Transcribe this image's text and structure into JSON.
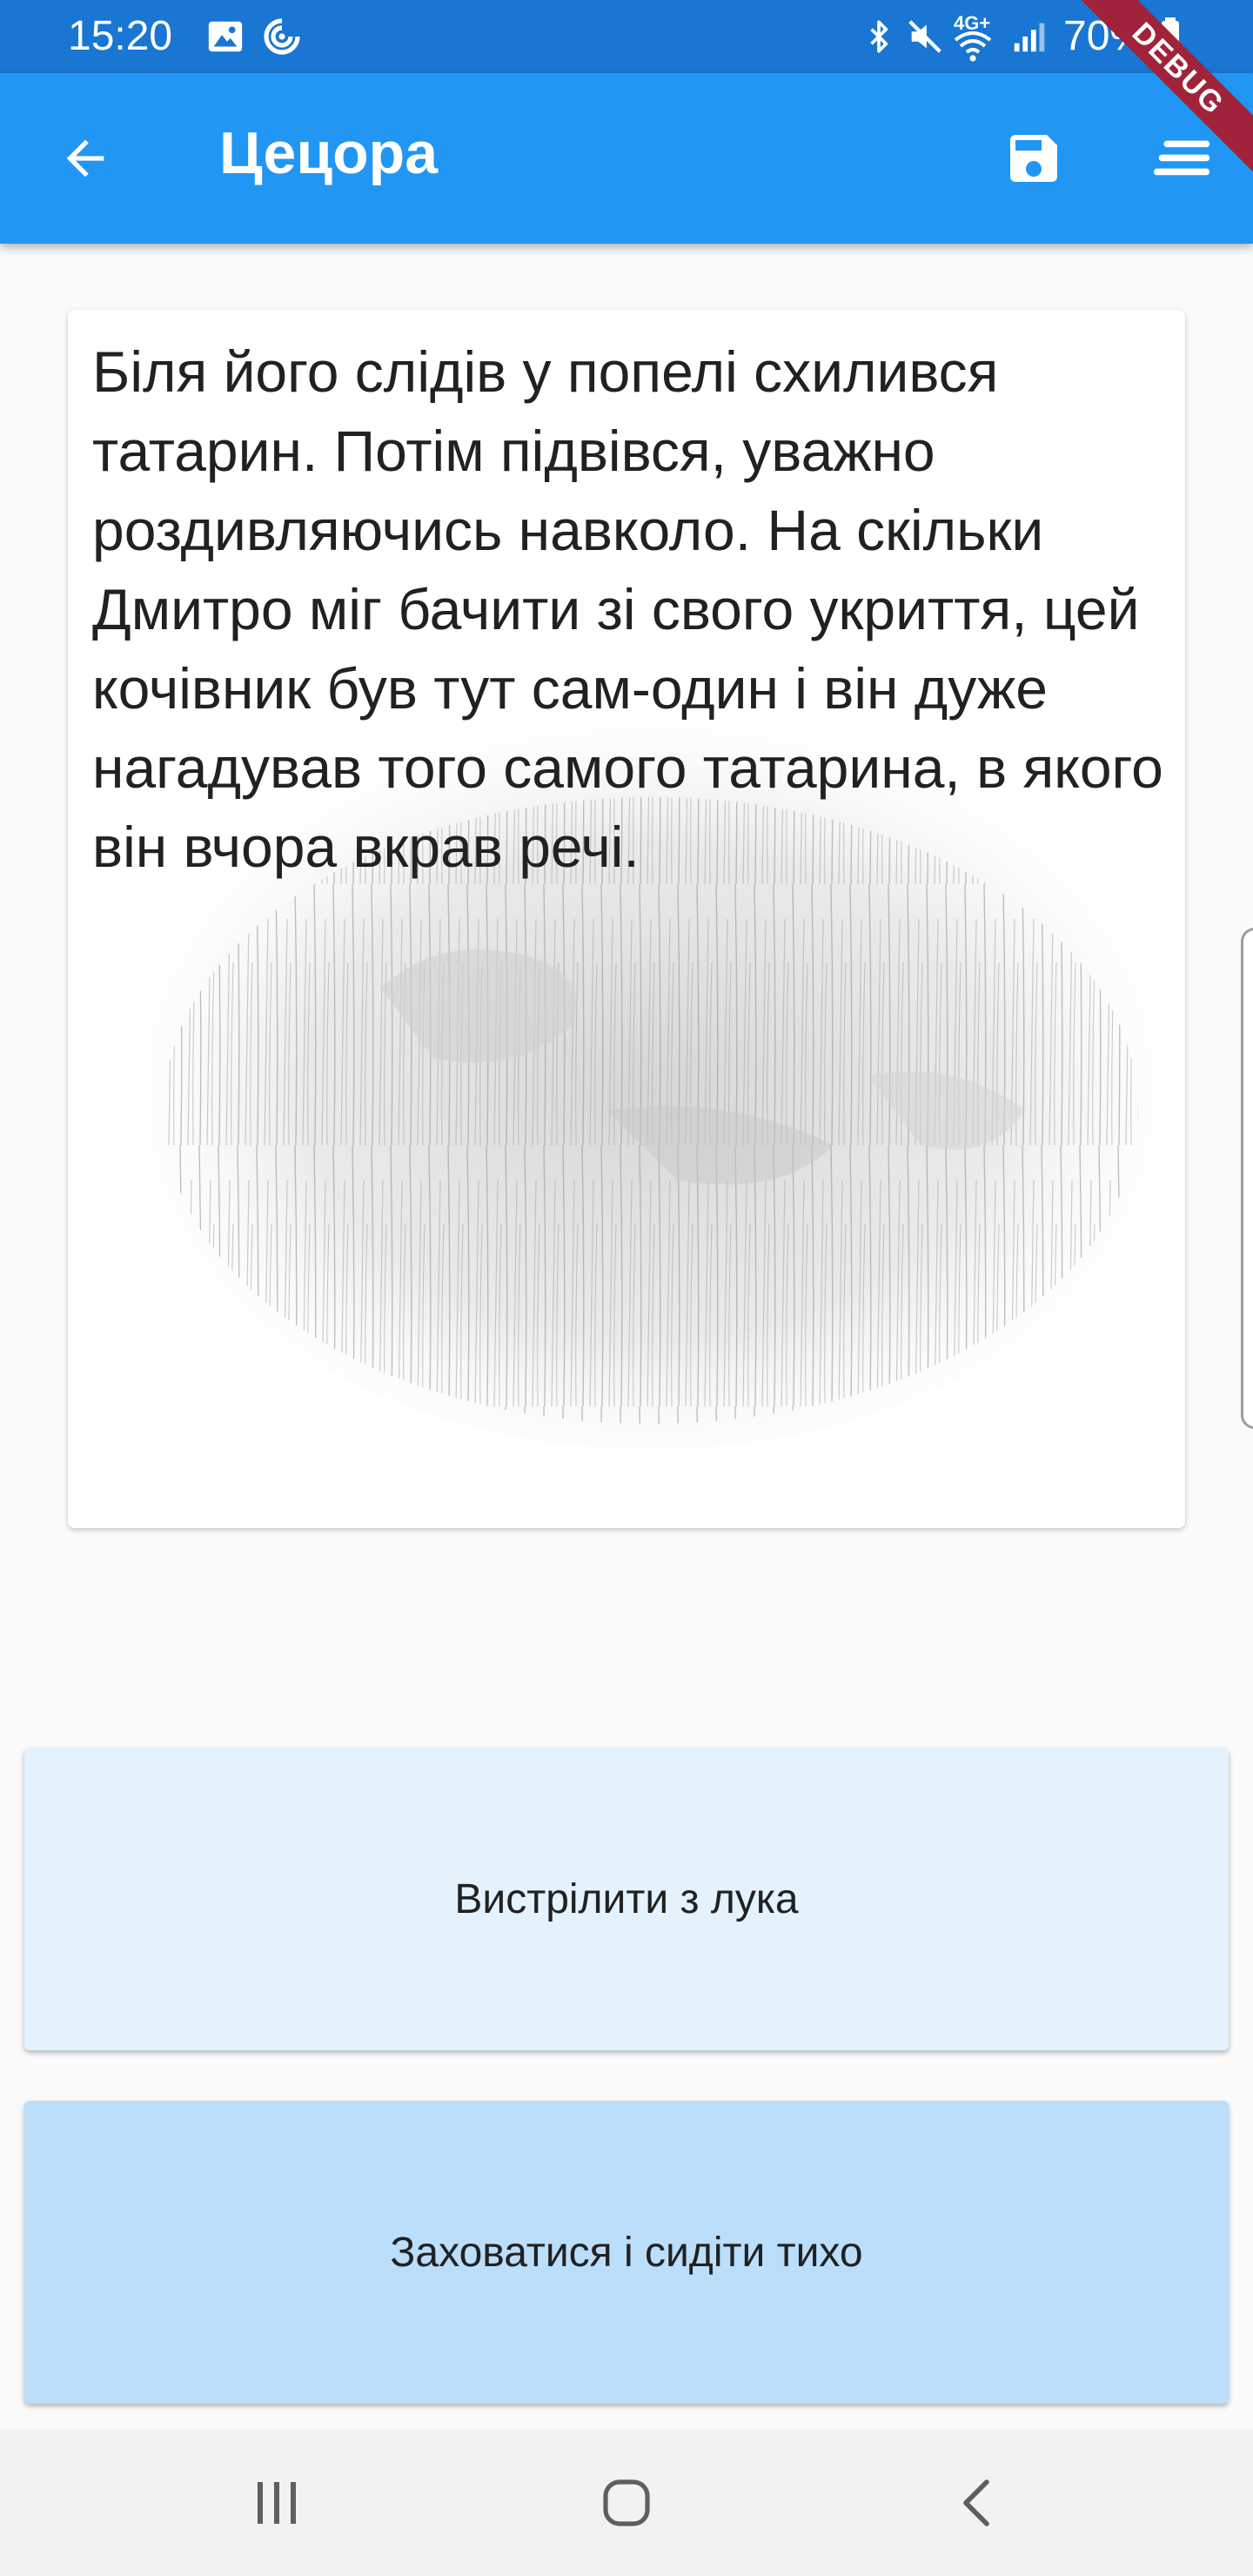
{
  "status_bar": {
    "time": "15:20",
    "battery_percent": "70%",
    "network_label": "4G+",
    "icons": [
      "image-icon",
      "sync-icon",
      "bluetooth-icon",
      "mute-icon",
      "wifi-icon",
      "signal-icon",
      "battery-icon"
    ]
  },
  "debug_banner": {
    "label": "DEBUG"
  },
  "app_bar": {
    "title": "Цецора",
    "background_color": "#2196f3",
    "icons": [
      "back-arrow-icon",
      "save-icon",
      "menu-icon"
    ]
  },
  "story": {
    "text": "Біля його слідів у попелі схилився татарин. Потім підвівся, уважно роздивляючись навколо. На скільки Дмитро міг бачити зі свого укриття, цей кочівник був тут сам-один і він дуже нагадував того самого татарина, в якого він вчора вкрав речі."
  },
  "choices": [
    {
      "label": "Вистрілити з лука",
      "color": "#e3f2fd"
    },
    {
      "label": "Заховатися і сидіти тихо",
      "color": "#bbdefb"
    }
  ],
  "nav_bar": {
    "icons": [
      "recent-apps-icon",
      "home-icon",
      "back-icon"
    ]
  }
}
